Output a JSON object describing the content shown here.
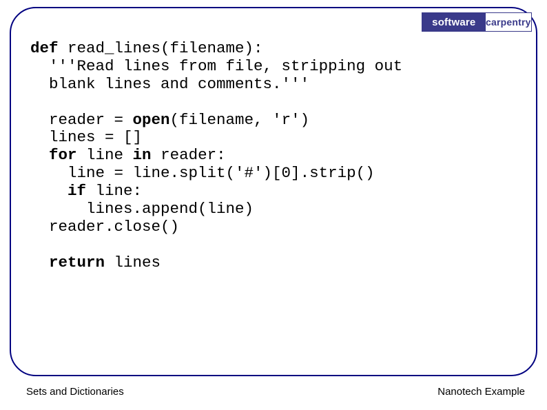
{
  "logo": {
    "left": "software",
    "right": "carpentry"
  },
  "code": {
    "l1a": "def",
    "l1b": " read_lines(filename):",
    "l2": "  '''Read lines from file, stripping out",
    "l3": "  blank lines and comments.'''",
    "blank1": "",
    "l4a": "  reader = ",
    "l4b": "open",
    "l4c": "(filename, 'r')",
    "l5": "  lines = []",
    "l6a": "  ",
    "l6b": "for",
    "l6c": " line ",
    "l6d": "in",
    "l6e": " reader:",
    "l7": "    line = line.split('#')[0].strip()",
    "l8a": "    ",
    "l8b": "if",
    "l8c": " line:",
    "l9": "      lines.append(line)",
    "l10": "  reader.close()",
    "blank2": "",
    "l11a": "  ",
    "l11b": "return",
    "l11c": " lines"
  },
  "footer": {
    "left": "Sets and Dictionaries",
    "right": "Nanotech Example"
  }
}
